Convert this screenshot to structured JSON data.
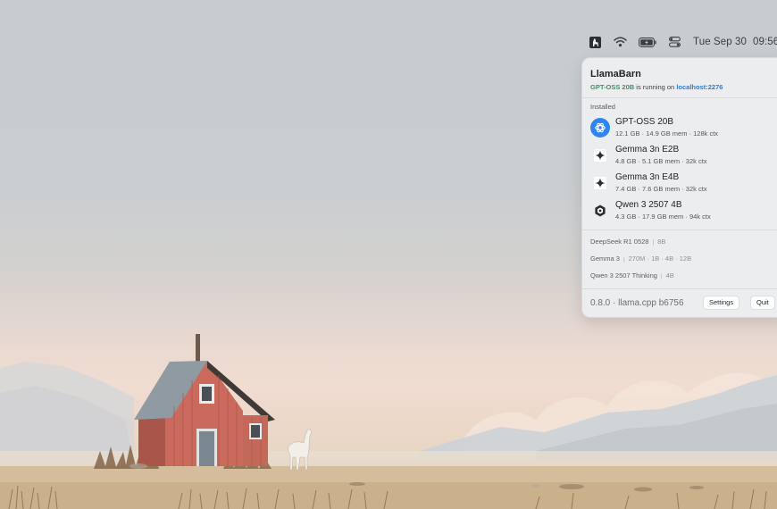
{
  "menubar": {
    "app_icon": "llama-icon",
    "wifi_icon": "wifi-icon",
    "battery_icon": "battery-icon",
    "control_center_icon": "control-center-icon",
    "date": "Tue Sep 30",
    "time": "09:56"
  },
  "panel": {
    "title": "LlamaBarn",
    "status": {
      "model": "GPT-OSS 20B",
      "middle": " is running on ",
      "host": "localhost:2276"
    },
    "installed_label": "Installed",
    "installed": [
      {
        "name": "GPT-OSS 20B",
        "meta": "12.1 GB · 14.9 GB mem · 128k ctx",
        "icon": "openai-icon",
        "active": true
      },
      {
        "name": "Gemma 3n E2B",
        "meta": "4.8 GB · 5.1 GB mem · 32k ctx",
        "icon": "gemma-icon",
        "active": false
      },
      {
        "name": "Gemma 3n E4B",
        "meta": "7.4 GB · 7.6 GB mem · 32k ctx",
        "icon": "gemma-icon",
        "active": false
      },
      {
        "name": "Qwen 3 2507 4B",
        "meta": "4.3 GB · 17.9 GB mem · 94k ctx",
        "icon": "qwen-icon",
        "active": false
      }
    ],
    "catalog": [
      {
        "name": "DeepSeek R1 0528",
        "variants": "8B"
      },
      {
        "name": "Gemma 3",
        "variants": "270M · 1B · 4B · 12B"
      },
      {
        "name": "Qwen 3 2507 Thinking",
        "variants": "4B"
      }
    ],
    "chevron": "›",
    "version": "0.8.0 · llama.cpp b6756",
    "settings_label": "Settings",
    "quit_label": "Quit"
  },
  "colors": {
    "running_model": "#2e9b62",
    "host_link": "#2f7ad6",
    "active_icon_bg": "#2f86f0"
  }
}
